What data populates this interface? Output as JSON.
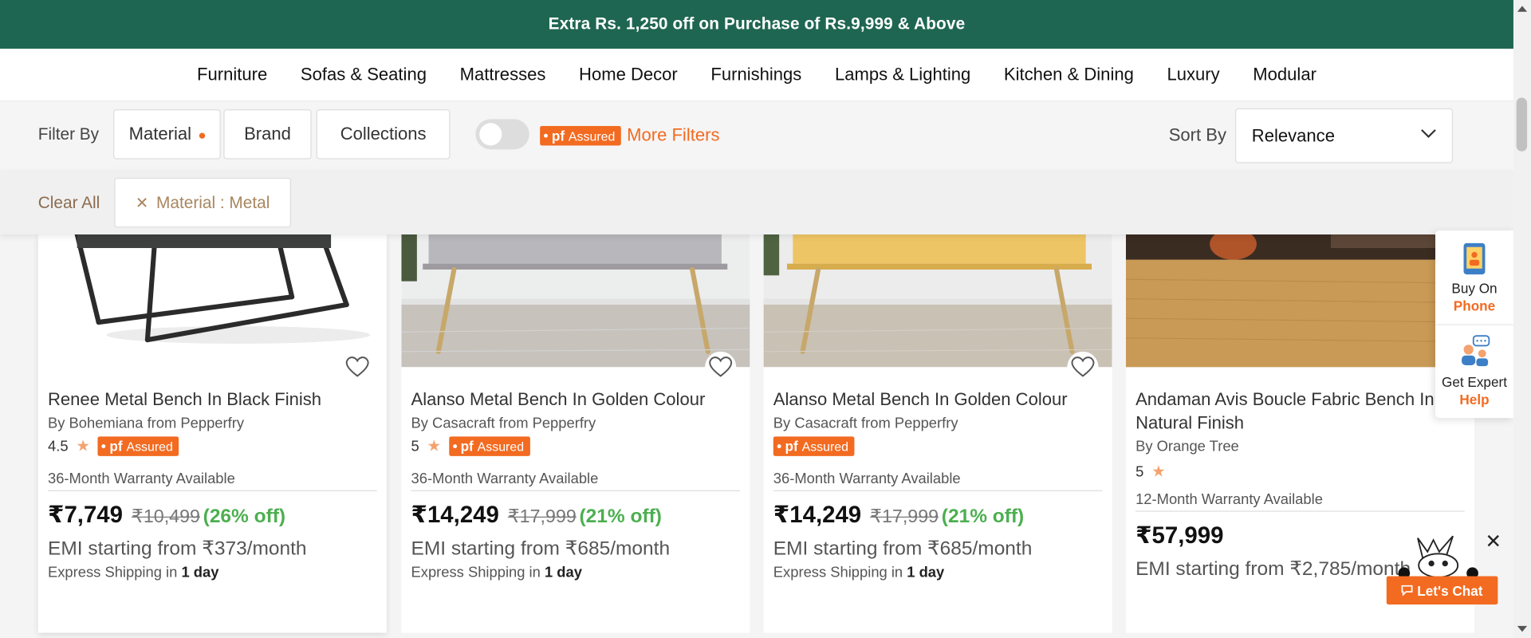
{
  "promo": {
    "text": "Extra Rs. 1,250 off on Purchase of Rs.9,999 & Above"
  },
  "nav": {
    "items": [
      "Furniture",
      "Sofas & Seating",
      "Mattresses",
      "Home Decor",
      "Furnishings",
      "Lamps & Lighting",
      "Kitchen & Dining",
      "Luxury",
      "Modular"
    ]
  },
  "filters": {
    "filter_by_label": "Filter By",
    "chips": [
      "Material",
      "Brand",
      "Collections"
    ],
    "pf_assured_toggle": false,
    "pf_badge": {
      "brand": "pf",
      "text": "Assured"
    },
    "more_filters": "More Filters",
    "sort_label": "Sort By",
    "sort_value": "Relevance",
    "clear_all": "Clear All",
    "applied_chip": "Material : Metal"
  },
  "products": [
    {
      "title": "Renee Metal Bench In Black Finish",
      "by": "By Bohemiana from Pepperfry",
      "rating": "4.5",
      "pf_assured": true,
      "warranty": "36-Month Warranty Available",
      "price": "₹7,749",
      "mrp": "₹10,499",
      "discount": "(26% off)",
      "emi": "EMI starting from ₹373/month",
      "shipping_prefix": "Express Shipping in",
      "shipping_days": "1 day"
    },
    {
      "title": "Alanso Metal Bench In Golden Colour",
      "by": "By Casacraft from Pepperfry",
      "rating": "5",
      "pf_assured": true,
      "warranty": "36-Month Warranty Available",
      "price": "₹14,249",
      "mrp": "₹17,999",
      "discount": "(21% off)",
      "emi": "EMI starting from ₹685/month",
      "shipping_prefix": "Express Shipping in",
      "shipping_days": "1 day"
    },
    {
      "title": "Alanso Metal Bench In Golden Colour",
      "by": "By Casacraft from Pepperfry",
      "rating": "",
      "pf_assured": true,
      "warranty": "36-Month Warranty Available",
      "price": "₹14,249",
      "mrp": "₹17,999",
      "discount": "(21% off)",
      "emi": "EMI starting from ₹685/month",
      "shipping_prefix": "Express Shipping in",
      "shipping_days": "1 day"
    },
    {
      "title": "Andaman Avis Boucle Fabric Bench In Natural Finish",
      "by": "By Orange Tree",
      "rating": "5",
      "pf_assured": false,
      "warranty": "12-Month Warranty Available",
      "price": "₹57,999",
      "emi": "EMI starting from ₹2,785/month"
    }
  ],
  "side_help": {
    "buy_on": "Buy On",
    "phone": "Phone",
    "get_expert": "Get Expert",
    "help": "Help"
  },
  "chat": {
    "label": "Let's Chat"
  },
  "colors": {
    "promo_bg": "#1f6652",
    "accent": "#f26b21",
    "discount": "#4caf50",
    "applied_chip_text": "#a8865f"
  }
}
